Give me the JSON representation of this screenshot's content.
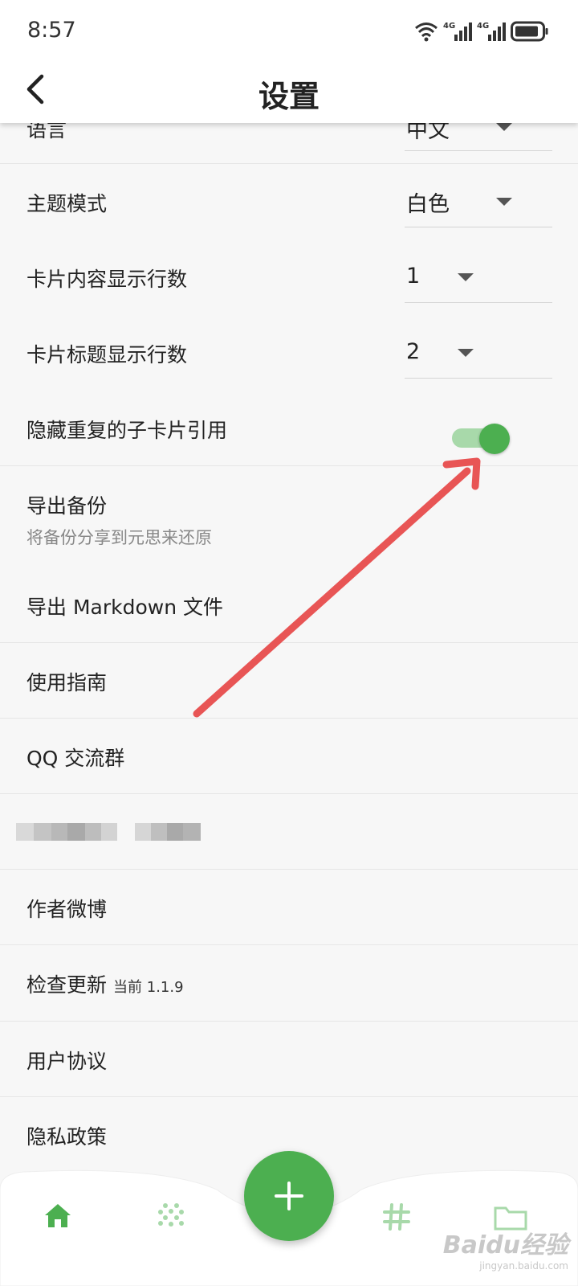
{
  "status_bar": {
    "time": "8:57",
    "icons": [
      "wifi-icon",
      "signal-4g-icon",
      "signal-4g-icon",
      "battery-icon"
    ],
    "network_label": "4G"
  },
  "app_bar": {
    "title": "设置",
    "back_icon": "back-arrow-icon"
  },
  "settings": {
    "language": {
      "label": "语言",
      "value": "中文"
    },
    "theme": {
      "label": "主题模式",
      "value": "白色"
    },
    "card_content_lines": {
      "label": "卡片内容显示行数",
      "value": "1"
    },
    "card_title_lines": {
      "label": "卡片标题显示行数",
      "value": "2"
    },
    "hide_duplicate": {
      "label": "隐藏重复的子卡片引用",
      "enabled": true
    },
    "export_backup": {
      "label": "导出备份",
      "sublabel": "将备份分享到元思来还原"
    },
    "export_markdown": {
      "label": "导出 Markdown 文件"
    },
    "guide": {
      "label": "使用指南"
    },
    "qq_group": {
      "label": "QQ 交流群"
    },
    "author_weibo": {
      "label": "作者微博"
    },
    "check_update": {
      "label": "检查更新",
      "version_label": "当前 1.1.9"
    },
    "user_agreement": {
      "label": "用户协议"
    },
    "privacy_policy": {
      "label": "隐私政策"
    }
  },
  "bottom_nav": {
    "fab_icon": "plus-icon",
    "items": [
      "home-icon",
      "dots-grid-icon",
      "hashtag-icon",
      "folder-icon"
    ]
  },
  "watermark": {
    "main": "Baidu经验",
    "sub": "jingyan.baidu.com"
  },
  "colors": {
    "accent": "#4caf50",
    "accent_light": "#a8d9aa",
    "annotation_arrow": "#e85555",
    "background": "#f7f7f7"
  }
}
